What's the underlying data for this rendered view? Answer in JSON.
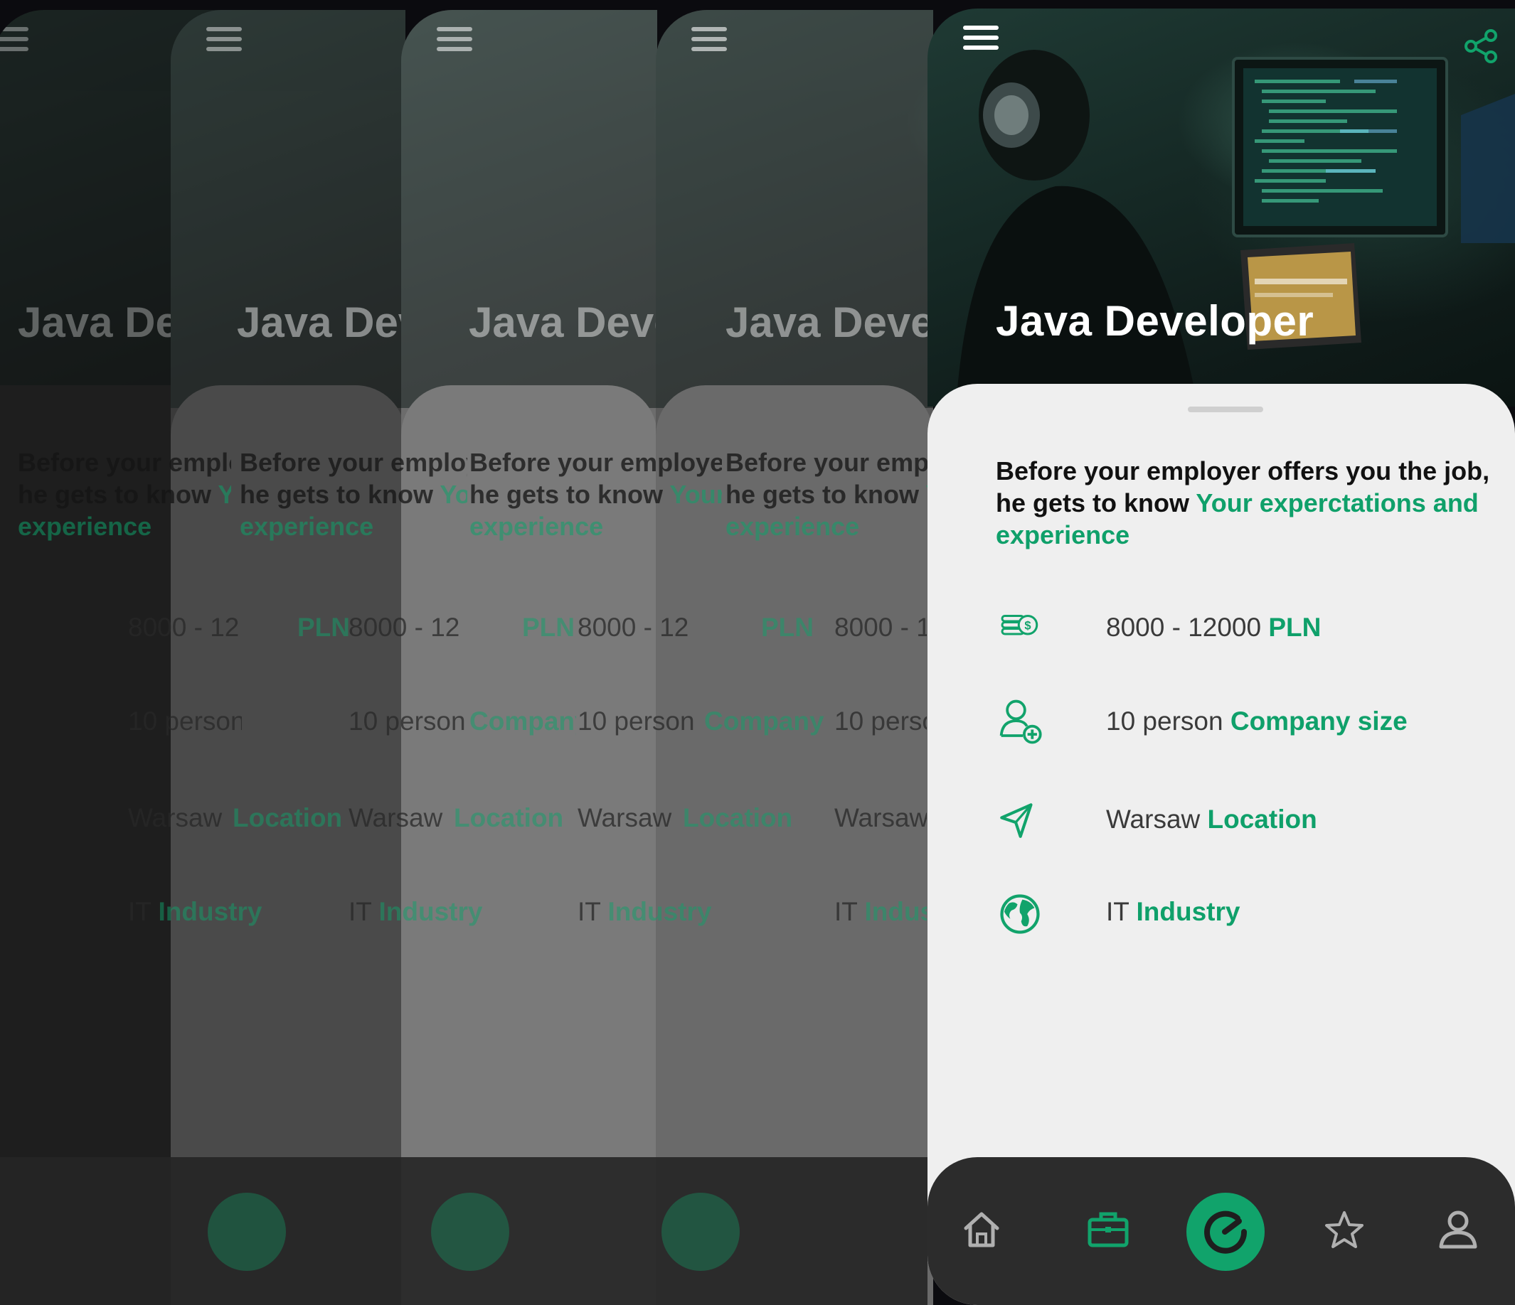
{
  "job": {
    "title": "Java Developer",
    "intro_prefix": "Before your employer offers you the job, he gets to know ",
    "intro_accent": "Your experctations and experience"
  },
  "details": [
    {
      "icon": "coins-icon",
      "value": "8000 - 12000",
      "label": "PLN"
    },
    {
      "icon": "add-person-icon",
      "value": "10 person",
      "label": "Company size"
    },
    {
      "icon": "location-arrow-icon",
      "value": "Warsaw",
      "label": "Location"
    },
    {
      "icon": "globe-icon",
      "value": "IT",
      "label": "Industry"
    }
  ],
  "nav": {
    "items": [
      "home-icon",
      "briefcase-icon",
      "refresh-icon",
      "star-icon",
      "user-icon"
    ],
    "active": "refresh-icon"
  },
  "ghost": {
    "titles": [
      "Java Devel",
      "Java Develo",
      "Java Develop",
      "Java Devel"
    ],
    "intro_line1": [
      "Before your emplo",
      "Before your employ",
      "Before your employe",
      "Before your empl"
    ],
    "intro_line2": [
      "he gets to know ",
      "he gets to know ",
      "he gets to know ",
      "he gets to know "
    ],
    "intro_line2_accent": [
      "Yo",
      "Yo",
      "Your",
      "Y"
    ],
    "intro_line3": "experience",
    "row_values": [
      "8000 - 12",
      "10 person",
      "Warsaw",
      "IT"
    ],
    "row_labels_short": [
      "PLN",
      "Company size",
      "Location",
      "Industry"
    ]
  },
  "colors": {
    "accent": "#0fa06a",
    "sheet": "#efefef",
    "tabbar": "#2c2c2c",
    "hero": "#1f3a34"
  }
}
